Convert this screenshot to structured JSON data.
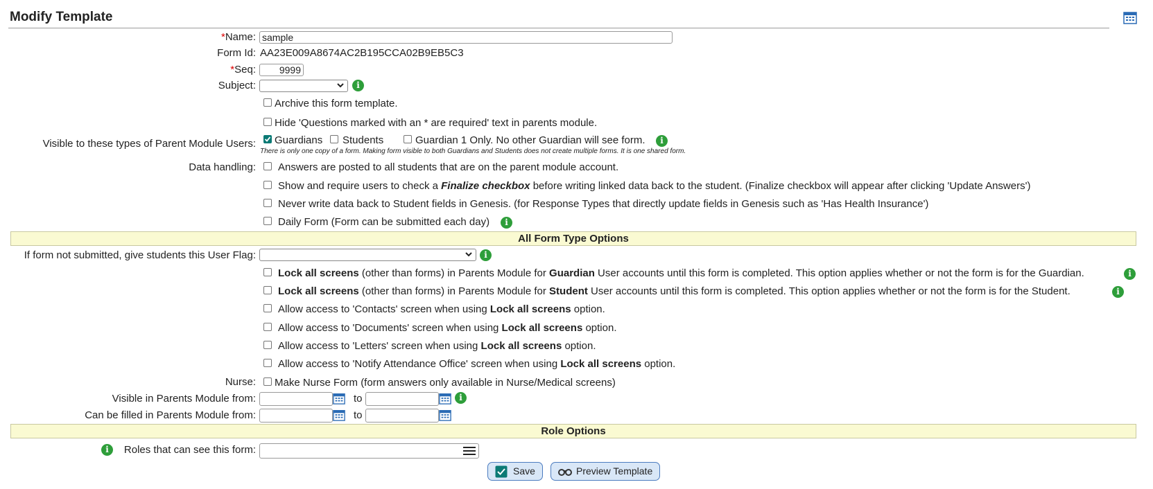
{
  "header": {
    "title": "Modify Template",
    "calendar_icon": "calendar-icon"
  },
  "fields": {
    "name_required": "*",
    "name_label": "Name:",
    "name_value": "sample",
    "form_id_label": "Form Id:",
    "form_id_value": "AA23E009A8674AC2B195CCA02B9EB5C3",
    "seq_required": "*",
    "seq_label": "Seq:",
    "seq_value": "9999",
    "subject_label": "Subject:",
    "subject_value": "",
    "archive_label": "Archive this form template.",
    "hide_required_label": "Hide 'Questions marked with an * are required' text in parents module."
  },
  "visibility": {
    "label": "Visible to these types of Parent Module Users:",
    "guardians_label": "Guardians",
    "guardians_checked": true,
    "students_label": "Students",
    "students_checked": false,
    "guardian1_label": "Guardian 1 Only. No other Guardian will see form.",
    "guardian1_checked": false,
    "note": "There is only one copy of a form. Making form visible to both Guardians and Students does not create multiple forms. It is one shared form."
  },
  "data_handling": {
    "label": "Data handling:",
    "opt1": "Answers are posted to all students that are on the parent module account.",
    "opt2_pre": "Show and require users to check a ",
    "opt2_bold": "Finalize checkbox",
    "opt2_post": " before writing linked data back to the student. (Finalize checkbox will appear after clicking 'Update Answers')",
    "opt3": "Never write data back to Student fields in Genesis. (for Response Types that directly update fields in Genesis such as 'Has Health Insurance')",
    "opt4": "Daily Form (Form can be submitted each day)"
  },
  "all_form_type": {
    "header": "All Form Type Options",
    "user_flag_label": "If form not submitted, give students this User Flag:",
    "user_flag_value": "",
    "lock_guardian_b1": "Lock all screens",
    "lock_guardian_t1": " (other than forms) in Parents Module for ",
    "lock_guardian_b2": "Guardian",
    "lock_guardian_t2": " User accounts until this form is completed. This option applies whether or not the form is for the Guardian.",
    "lock_student_b1": "Lock all screens",
    "lock_student_t1": " (other than forms) in Parents Module for ",
    "lock_student_b2": "Student",
    "lock_student_t2": " User accounts until this form is completed. This option applies whether or not the form is for the Student.",
    "allow_contacts_pre": "Allow access to 'Contacts' screen when using ",
    "allow_documents_pre": "Allow access to 'Documents' screen when using ",
    "allow_letters_pre": "Allow access to 'Letters' screen when using ",
    "allow_notify_pre": "Allow access to 'Notify Attendance Office' screen when using ",
    "lock_bold": "Lock all screens",
    "option_suffix": " option.",
    "nurse_label": "Nurse:",
    "nurse_opt": "Make Nurse Form (form answers only available in Nurse/Medical screens)",
    "visible_from_label": "Visible in Parents Module from:",
    "filled_from_label": "Can be filled in Parents Module from:",
    "to_label": "to"
  },
  "role_options": {
    "header": "Role Options",
    "roles_label": "Roles that can see this form:",
    "roles_value": ""
  },
  "actions": {
    "save_label": "Save",
    "preview_label": "Preview Template"
  },
  "colors": {
    "section_bg": "#fafad2",
    "info_green": "#2e9e3a",
    "button_bg": "#d9e7f7",
    "required_red": "#d00"
  }
}
